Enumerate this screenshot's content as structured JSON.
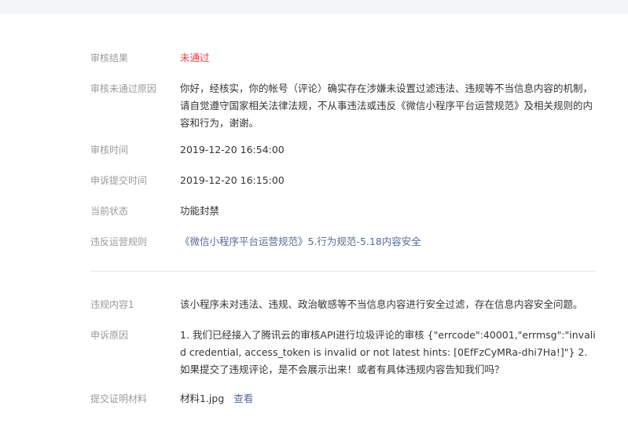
{
  "review": {
    "result_label": "审核结果",
    "result_value": "未通过",
    "reason_label": "审核未通过原因",
    "reason_value": "你好，经核实，你的帐号（评论）确实存在涉嫌未设置过滤违法、违规等不当信息内容的机制，请自觉遵守国家相关法律法规，不从事违法或违反《微信小程序平台运营规范》及相关规则的内容和行为，谢谢。",
    "review_time_label": "审核时间",
    "review_time_value": "2019-12-20 16:54:00",
    "appeal_time_label": "申诉提交时间",
    "appeal_time_value": "2019-12-20 16:15:00",
    "status_label": "当前状态",
    "status_value": "功能封禁",
    "rule_label": "违反运营规则",
    "rule_value": "《微信小程序平台运营规范》5.行为规范-5.18内容安全"
  },
  "violation": {
    "content_label": "违规内容1",
    "content_value": "该小程序未对违法、违规、政治敏感等不当信息内容进行安全过滤，存在信息内容安全问题。",
    "appeal_reason_label": "申诉原因",
    "appeal_reason_value": "1. 我们已经接入了腾讯云的审核API进行垃圾评论的审核 {\"errcode\":40001,\"errmsg\":\"invalid credential, access_token is invalid or not latest hints: [0EfFzCyMRa-dhi7Ha!]\"} 2. 如果提交了违规评论，是不会展示出来！或者有具体违规内容告知我们吗？",
    "evidence_label": "提交证明材料",
    "evidence_file": "材料1.jpg",
    "evidence_view": "查看"
  },
  "colors": {
    "label": "#9a9a9a",
    "text": "#353535",
    "fail": "#e64340",
    "link": "#576b95",
    "divider": "#e7e7eb",
    "topbar": "#f4f5f7"
  }
}
